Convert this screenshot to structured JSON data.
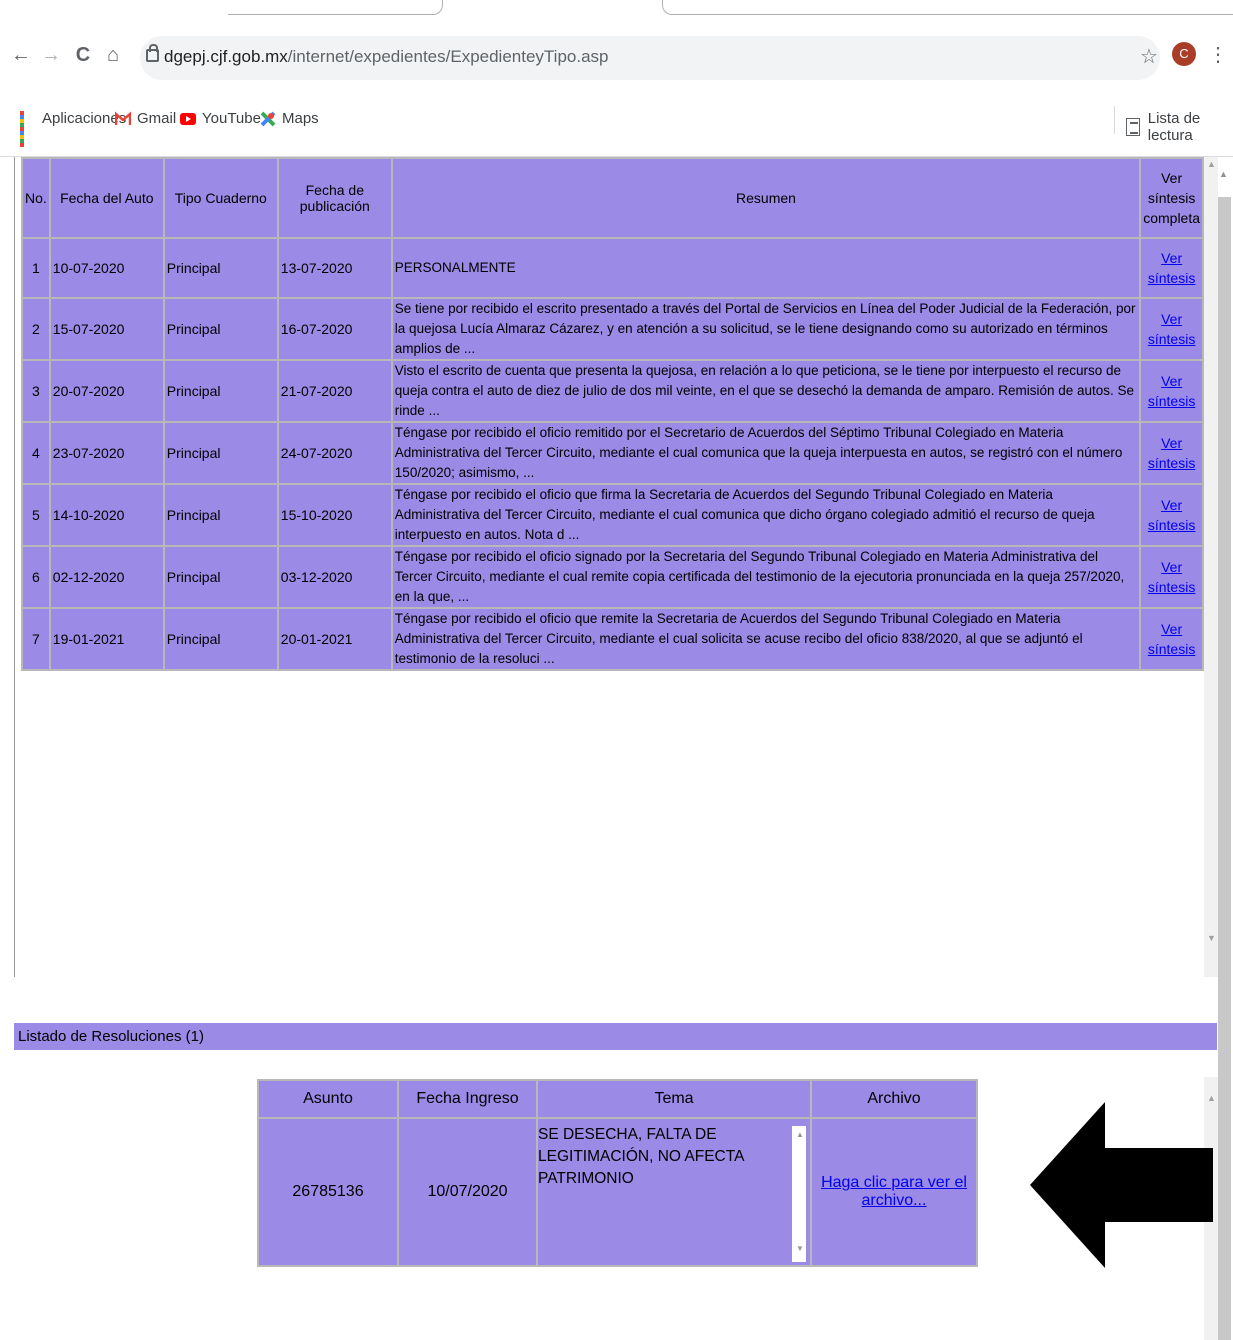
{
  "browser": {
    "url_domain": "dgepj.cjf.gob.mx",
    "url_path": "/internet/expedientes/ExpedienteyTipo.asp",
    "avatar_letter": "C",
    "nav": {
      "back": "←",
      "forward": "→",
      "reload": "C",
      "home": "⌂"
    },
    "star": "☆",
    "menu": "⋮"
  },
  "bookmarks": [
    {
      "label": "Aplicaciones",
      "icon": "apps-grid-icon"
    },
    {
      "label": "Gmail",
      "icon": "gmail-icon"
    },
    {
      "label": "YouTube",
      "icon": "youtube-icon"
    },
    {
      "label": "Maps",
      "icon": "maps-icon"
    }
  ],
  "reading_list": "Lista de lectura",
  "autos_table": {
    "headers": [
      "No.",
      "Fecha del Auto",
      "Tipo Cuaderno",
      "Fecha de publicación",
      "Resumen",
      "Ver síntesis completa"
    ],
    "rows": [
      {
        "no": "1",
        "fecha_auto": "10-07-2020",
        "tipo": "Principal",
        "fecha_pub": "13-07-2020",
        "resumen": "PERSONALMENTE",
        "link1": "Ver",
        "link2": "síntesis"
      },
      {
        "no": "2",
        "fecha_auto": "15-07-2020",
        "tipo": "Principal",
        "fecha_pub": "16-07-2020",
        "resumen": "Se tiene por recibido el escrito presentado a través del Portal de Servicios en Línea del Poder Judicial de la Federación, por la quejosa Lucía Almaraz Cázarez, y en atención a su solicitud, se le tiene designando como su autorizado en términos amplios de ...",
        "link1": "Ver",
        "link2": "síntesis"
      },
      {
        "no": "3",
        "fecha_auto": "20-07-2020",
        "tipo": "Principal",
        "fecha_pub": "21-07-2020",
        "resumen": "Visto el escrito de cuenta que presenta la quejosa, en relación a lo que peticiona, se le tiene por interpuesto el recurso de queja contra el auto de diez de julio de dos mil veinte, en el que se desechó la demanda de amparo. Remisión de autos. Se rinde ...",
        "link1": "Ver",
        "link2": "síntesis"
      },
      {
        "no": "4",
        "fecha_auto": "23-07-2020",
        "tipo": "Principal",
        "fecha_pub": "24-07-2020",
        "resumen": "Téngase por recibido el oficio remitido por el Secretario de Acuerdos del Séptimo Tribunal Colegiado en Materia Administrativa del Tercer Circuito, mediante el cual comunica que la queja interpuesta en autos, se registró con el número 150/2020; asimismo, ...",
        "link1": "Ver",
        "link2": "síntesis"
      },
      {
        "no": "5",
        "fecha_auto": "14-10-2020",
        "tipo": "Principal",
        "fecha_pub": "15-10-2020",
        "resumen": "Téngase por recibido el oficio que firma la Secretaria de Acuerdos del Segundo Tribunal Colegiado en Materia Administrativa del Tercer Circuito, mediante el cual comunica que dicho órgano colegiado admitió el recurso de queja interpuesto en autos. Nota d ...",
        "link1": "Ver",
        "link2": "síntesis"
      },
      {
        "no": "6",
        "fecha_auto": "02-12-2020",
        "tipo": "Principal",
        "fecha_pub": "03-12-2020",
        "resumen": "Téngase por recibido el oficio signado por la Secretaria del Segundo Tribunal Colegiado en Materia Administrativa del Tercer Circuito, mediante el cual remite copia certificada del testimonio de la ejecutoria pronunciada en la queja 257/2020, en la que, ...",
        "link1": "Ver",
        "link2": "síntesis"
      },
      {
        "no": "7",
        "fecha_auto": "19-01-2021",
        "tipo": "Principal",
        "fecha_pub": "20-01-2021",
        "resumen": "Téngase por recibido el oficio que remite la Secretaria de Acuerdos del Segundo Tribunal Colegiado en Materia Administrativa del Tercer Circuito, mediante el cual solicita se acuse recibo del oficio 838/2020, al que se adjuntó el testimonio de la resoluci ...",
        "link1": "Ver",
        "link2": "síntesis"
      }
    ]
  },
  "resoluciones": {
    "title": "Listado de Resoluciones (1)",
    "headers": [
      "Asunto",
      "Fecha Ingreso",
      "Tema",
      "Archivo"
    ],
    "row": {
      "asunto": "26785136",
      "fecha_ingreso": "10/07/2020",
      "tema": "SE DESECHA, FALTA DE LEGITIMACIÓN, NO AFECTA PATRIMONIO",
      "archivo_link": "Haga clic para ver el archivo..."
    }
  },
  "colors": {
    "table_fill": "#9b8be6",
    "link": "#0000ee",
    "annotation_arrow": "#000000"
  }
}
